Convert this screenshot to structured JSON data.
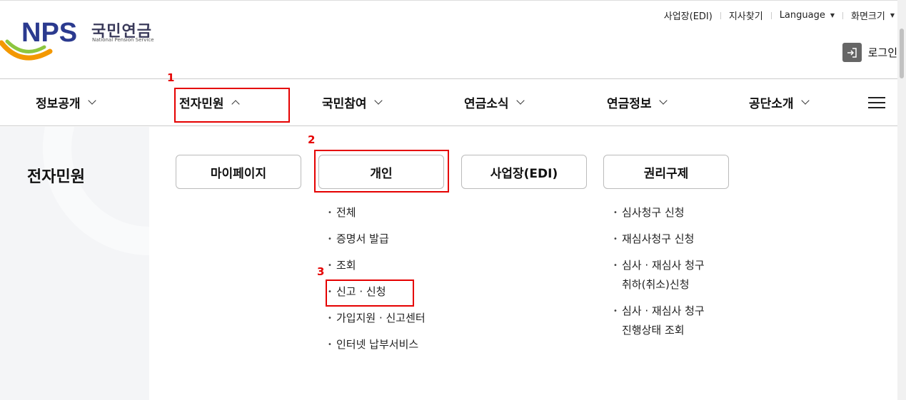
{
  "logo": {
    "letters": "NPS",
    "name_kr": "국민연금",
    "name_en": "National Pension Service"
  },
  "util_nav": [
    {
      "label": "사업장(EDI)",
      "has_caret": false
    },
    {
      "label": "지사찾기",
      "has_caret": false
    },
    {
      "label": "Language",
      "has_caret": true
    },
    {
      "label": "화면크기",
      "has_caret": true
    }
  ],
  "login": {
    "label": "로그인",
    "icon": "login-icon"
  },
  "gnb": [
    {
      "label": "정보공개",
      "expanded": false
    },
    {
      "label": "전자민원",
      "expanded": true
    },
    {
      "label": "국민참여",
      "expanded": false
    },
    {
      "label": "연금소식",
      "expanded": false
    },
    {
      "label": "연금정보",
      "expanded": false
    },
    {
      "label": "공단소개",
      "expanded": false
    }
  ],
  "side_title": "전자민원",
  "menu_buttons": [
    "마이페이지",
    "개인",
    "사업장(EDI)",
    "권리구제"
  ],
  "personal_items": [
    "전체",
    "증명서 발급",
    "조회",
    "신고 · 신청",
    "가입지원 · 신고센터",
    "인터넷 납부서비스"
  ],
  "relief_items": [
    {
      "line1": "심사청구 신청",
      "line2": ""
    },
    {
      "line1": "재심사청구 신청",
      "line2": ""
    },
    {
      "line1": "심사 · 재심사 청구",
      "line2": "취하(취소)신청"
    },
    {
      "line1": "심사 · 재심사 청구",
      "line2": "진행상태 조회"
    }
  ],
  "annotations": [
    "1",
    "2",
    "3"
  ],
  "colors": {
    "accent_red": "#e50000",
    "logo_navy": "#2b3a8f",
    "logo_orange": "#f39800",
    "logo_green": "#8cc63f"
  }
}
